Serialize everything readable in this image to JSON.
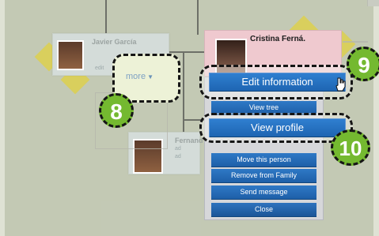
{
  "tree": {
    "people": [
      {
        "name": "Javier García"
      },
      {
        "name": "Fernand"
      }
    ],
    "more_label": "more",
    "more_arrow": "▼"
  },
  "profile": {
    "name": "Cristina Ferná."
  },
  "menu": {
    "items": [
      "Edit information",
      "View tree",
      "View profile",
      "Move this person",
      "Remove from Family",
      "Send message",
      "Close"
    ]
  },
  "callouts": [
    "8",
    "9",
    "10"
  ],
  "colors": {
    "accent_green": "#74b930",
    "menu_blue": "#2f79c6",
    "profile_pink": "#efc9cf",
    "background": "#cdd3c0"
  },
  "icons": [
    "hand-cursor-icon",
    "dropdown-triangle-icon"
  ]
}
